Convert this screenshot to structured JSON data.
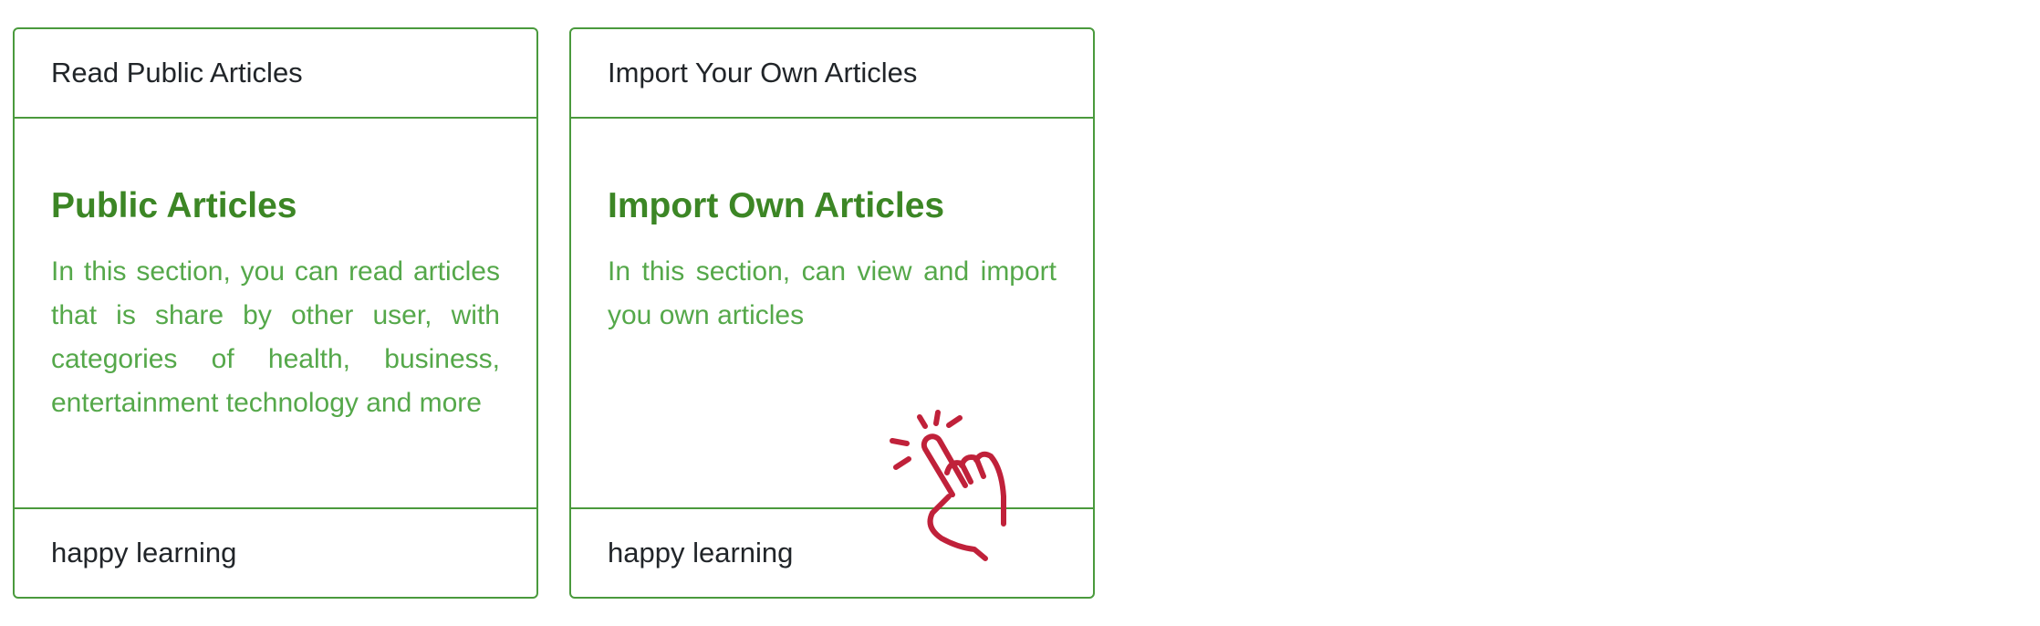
{
  "cards": [
    {
      "header": "Read Public Articles",
      "title": "Public Articles",
      "text": "In this section, you can read articles that is share by other user, with categories of health, business, entertainment technology and more",
      "footer": "happy learning"
    },
    {
      "header": "Import Your Own Articles",
      "title": "Import Own Articles",
      "text": "In this section, can view and import you own articles",
      "footer": "happy learning"
    }
  ],
  "pointer": {
    "icon": "tap-hand-icon",
    "color": "#c0213a"
  },
  "colors": {
    "border": "#4a9a3d",
    "title": "#3c8625",
    "text": "#55a84a"
  }
}
